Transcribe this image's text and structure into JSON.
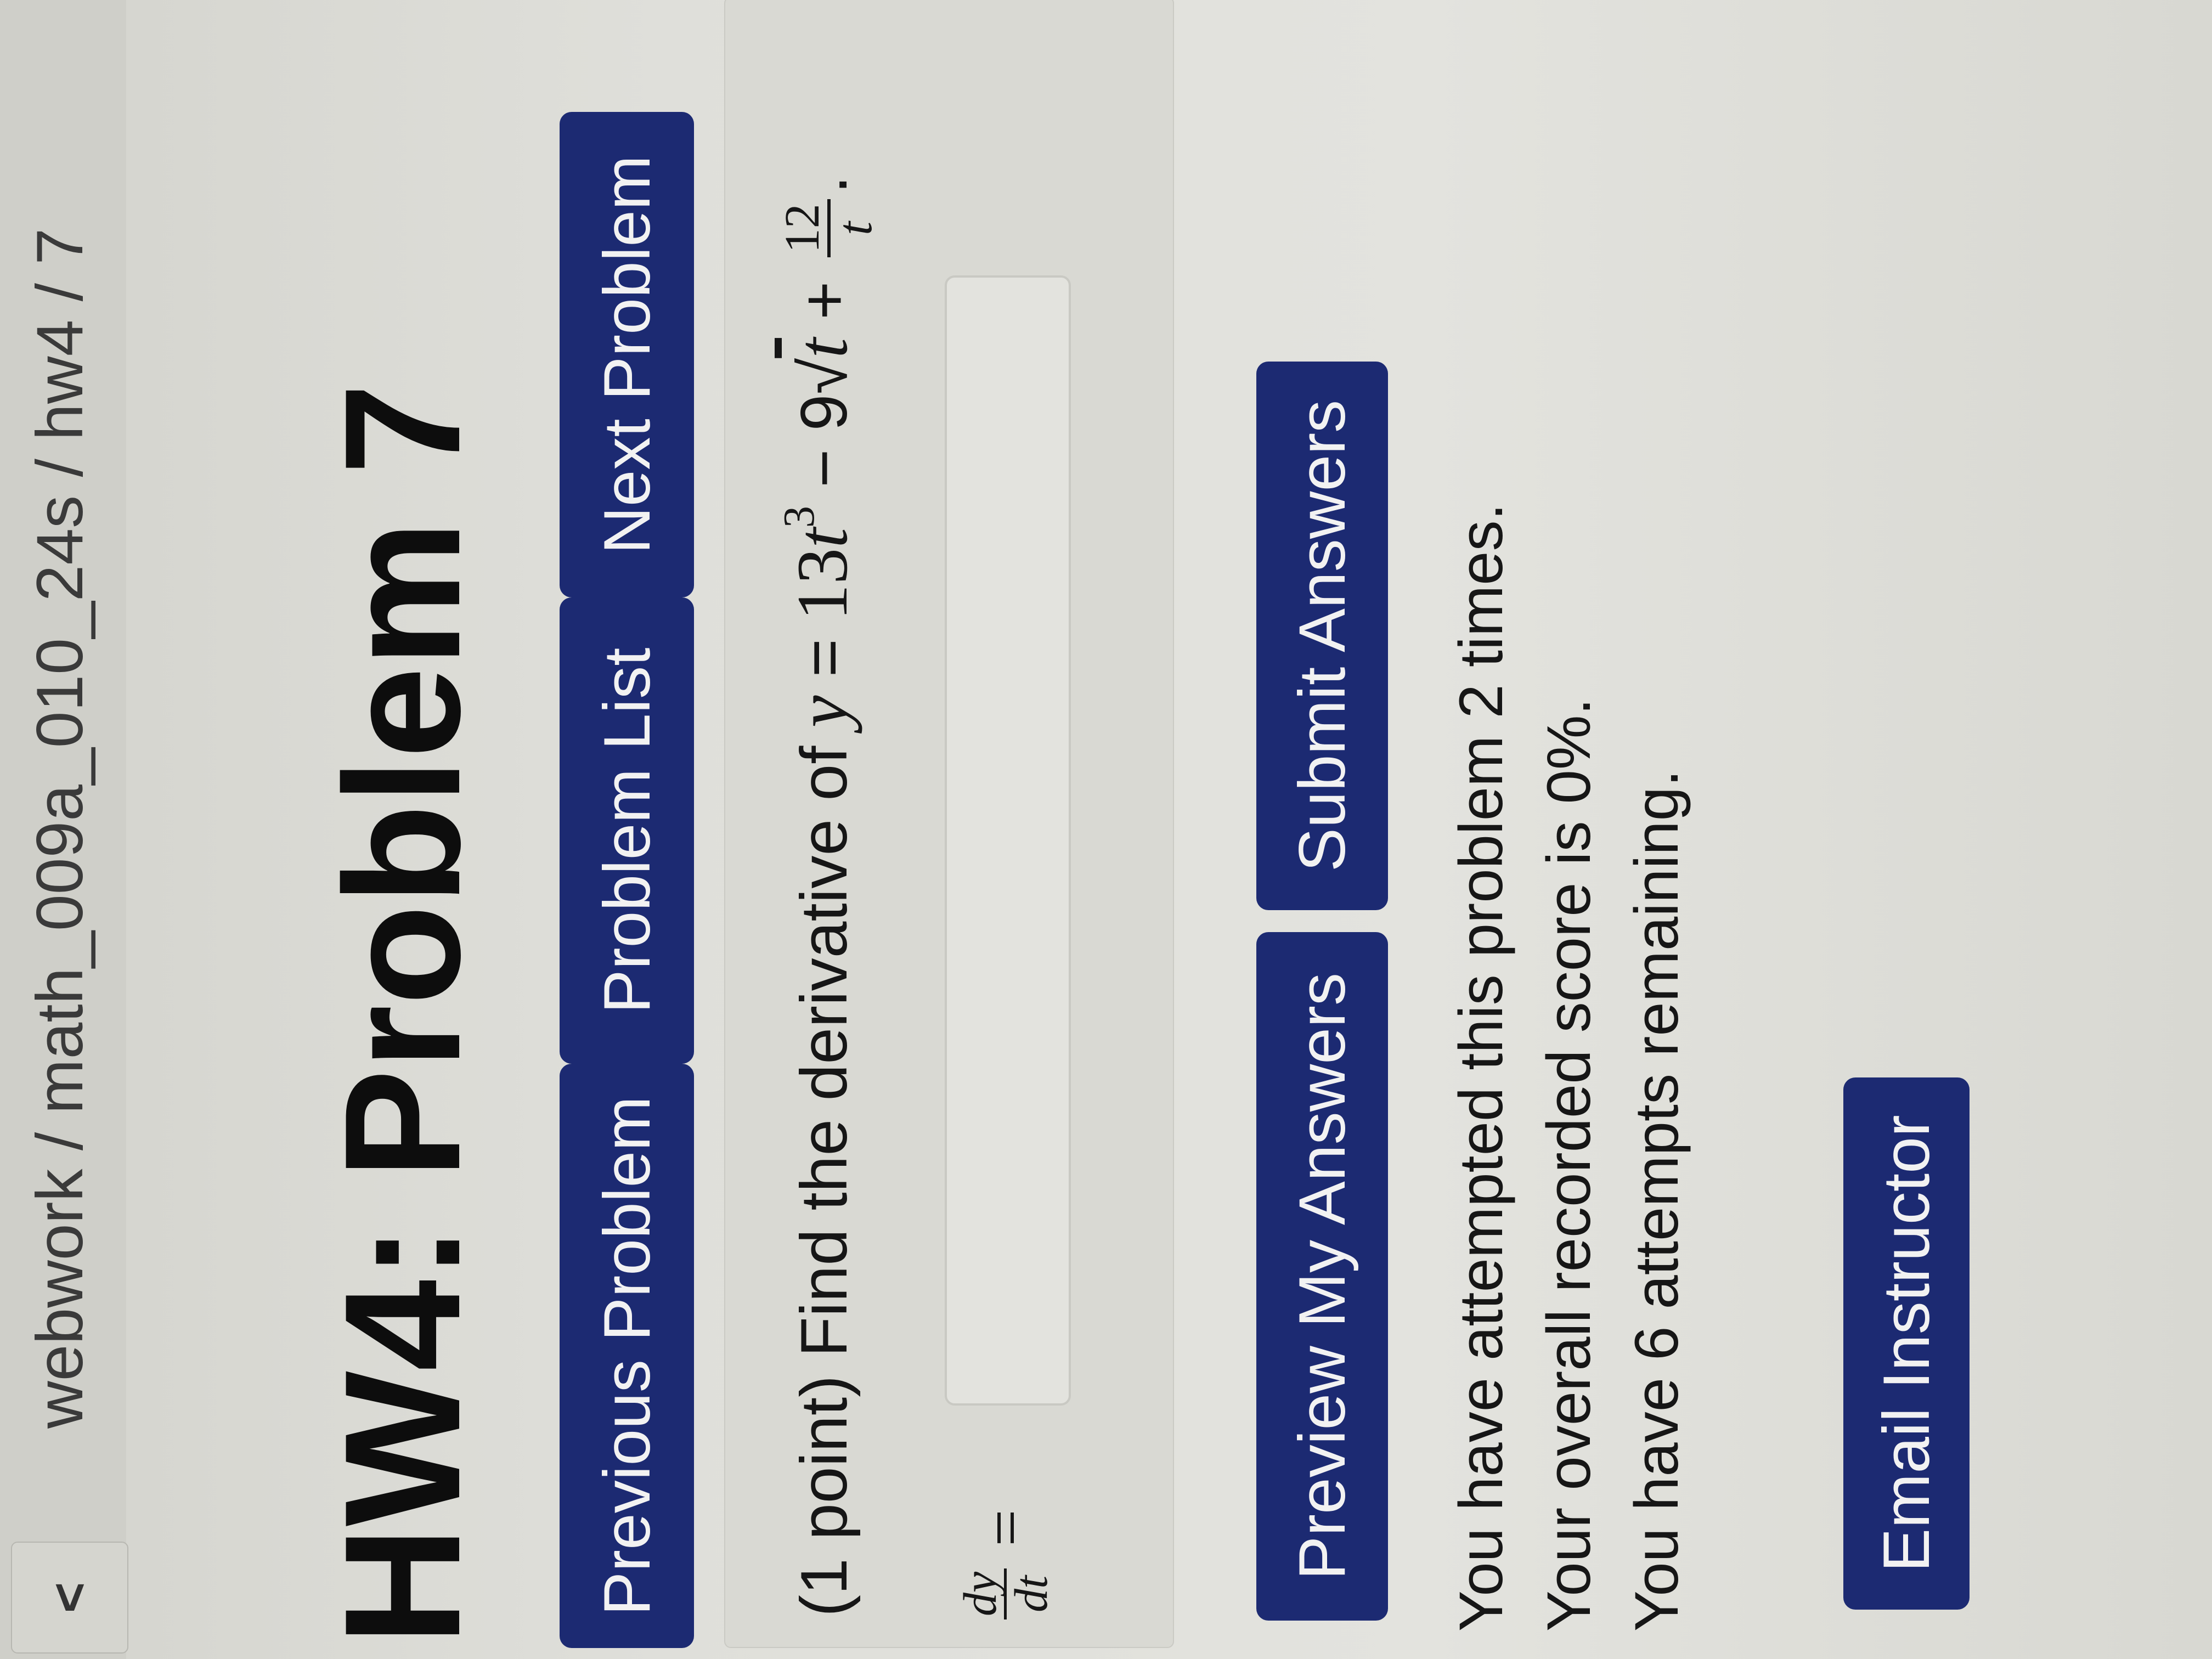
{
  "topbar": {
    "back_glyph": "<",
    "breadcrumb": "webwork / math_009a_010_24s / hw4 / 7"
  },
  "page_title": "HW4: Problem 7",
  "nav": {
    "previous": "Previous Problem",
    "list": "Problem List",
    "next": "Next Problem"
  },
  "problem": {
    "points": "(1 point)",
    "prompt": "Find the derivative of",
    "y": "y",
    "eq": " = ",
    "coef1": "13",
    "t1": "t",
    "exp": "3",
    "minus": " − 9",
    "sqrt": "√",
    "t2": "t",
    "plus": " + ",
    "frac_num": "12",
    "frac_den": "t",
    "end": "."
  },
  "answer": {
    "label_num": "dy",
    "label_den": "dt",
    "equals": "=",
    "value": ""
  },
  "actions": {
    "preview": "Preview My Answers",
    "submit": "Submit Answers"
  },
  "status": {
    "attempts": "You have attempted this problem 2 times.",
    "score": "Your overall recorded score is 0%.",
    "remaining": "You have 6 attempts remaining."
  },
  "email": "Email Instructor",
  "colors": {
    "button_bg": "#1c2a72",
    "button_text": "#f2f2f2"
  }
}
